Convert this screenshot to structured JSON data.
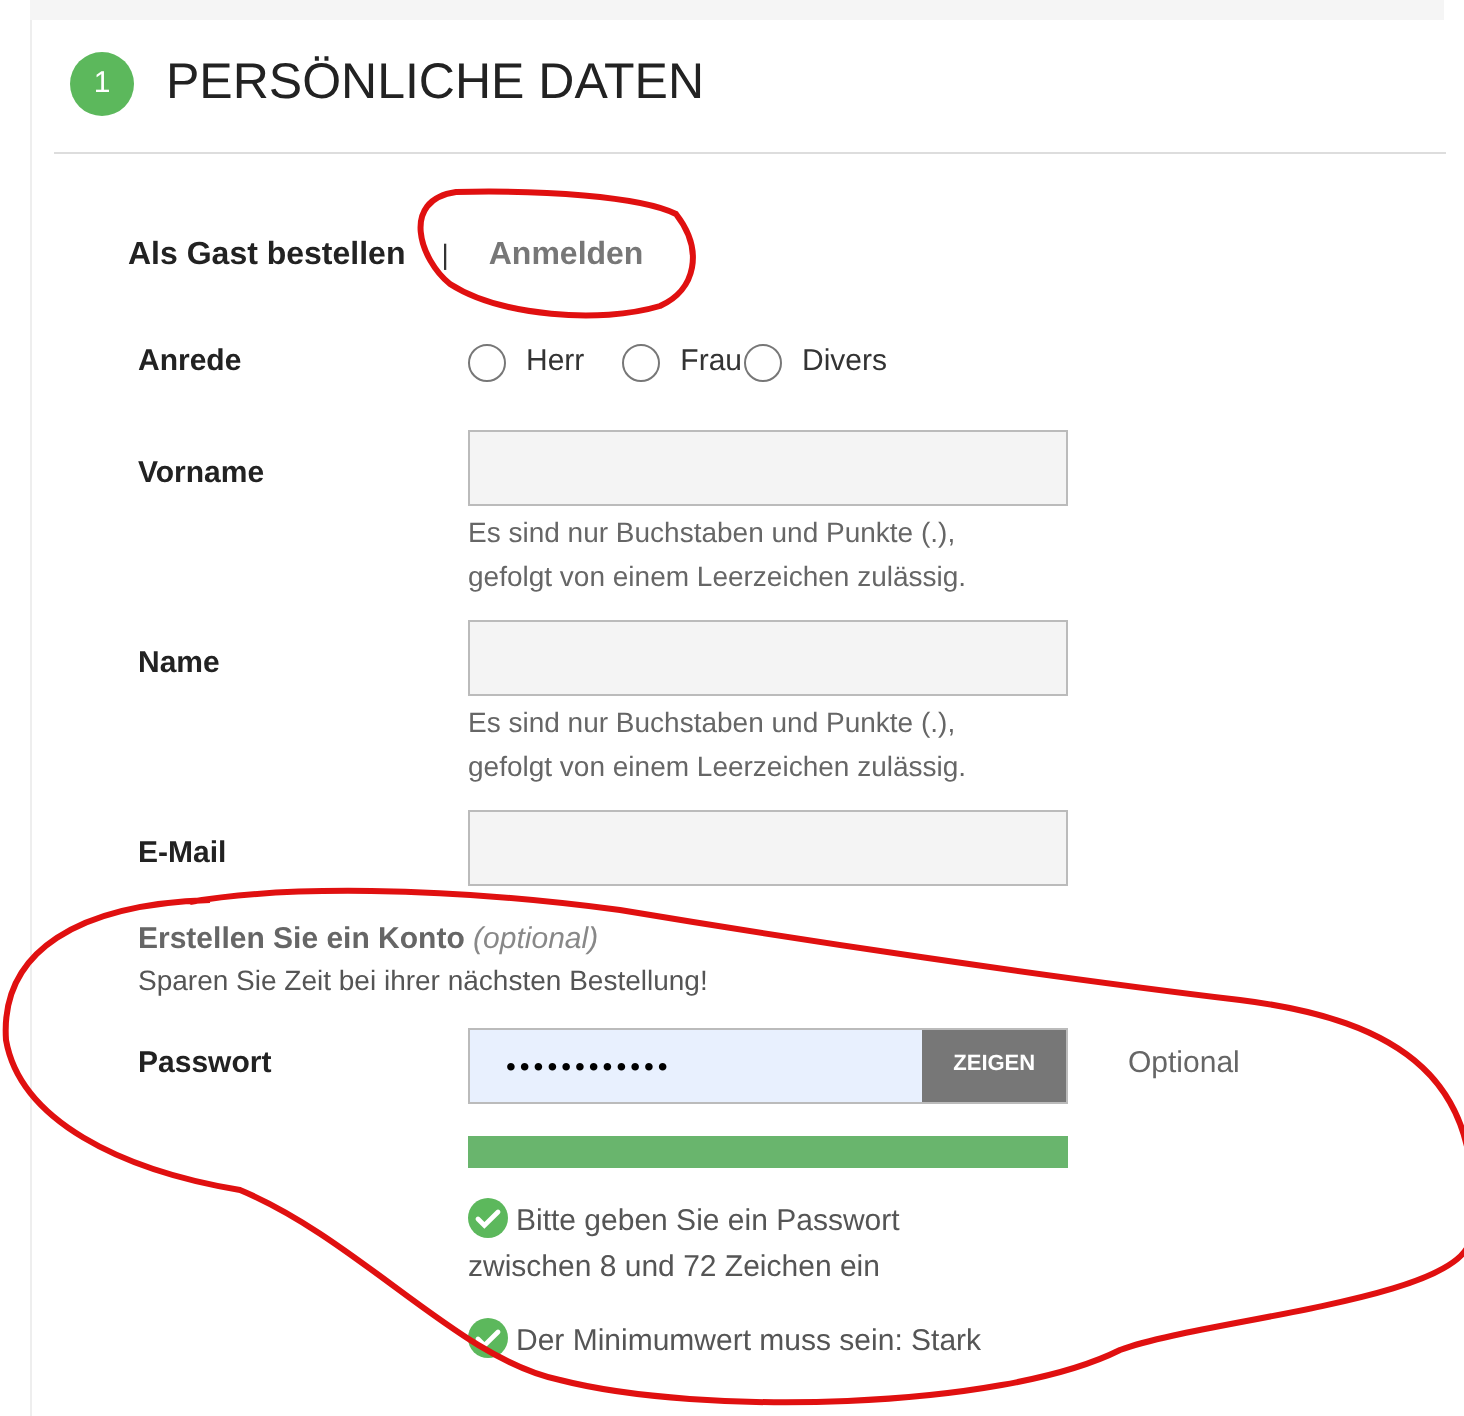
{
  "section": {
    "step": "1",
    "title": "PERSÖNLICHE DATEN"
  },
  "login_tabs": [
    {
      "label": "Als Gast bestellen",
      "selected": true
    },
    {
      "label": "Anmelden",
      "selected": false
    }
  ],
  "login_separator": "|",
  "salutation": {
    "label": "Anrede",
    "options": [
      {
        "label": "Herr",
        "selected": false
      },
      {
        "label": "Frau",
        "selected": false
      },
      {
        "label": "Divers",
        "selected": false
      }
    ]
  },
  "fields": [
    {
      "label": "Vorname",
      "hint": "Es sind nur Buchstaben und Punkte (.), gefolgt von einem Leerzeichen zulässig."
    },
    {
      "label": "Name",
      "hint": "Es sind nur Buchstaben und Punkte (.), gefolgt von einem Leerzeichen zulässig."
    },
    {
      "label": "E-Mail"
    }
  ],
  "account": {
    "title": "Erstellen Sie ein Konto",
    "optional": "(optional)",
    "subtitle": "Sparen Sie Zeit bei ihrer nächsten Bestellung!"
  },
  "password": {
    "label": "Passwort",
    "value": "••••••••••••",
    "button": "ZEIGEN",
    "note": "Optional",
    "strength": {
      "level": 1
    },
    "rules": [
      {
        "text": "Bitte geben Sie ein Passwort zwischen 8 und 72 Zeichen ein",
        "met": true
      },
      {
        "text": "Der Minimumwert muss sein: Stark",
        "met": true
      }
    ]
  }
}
